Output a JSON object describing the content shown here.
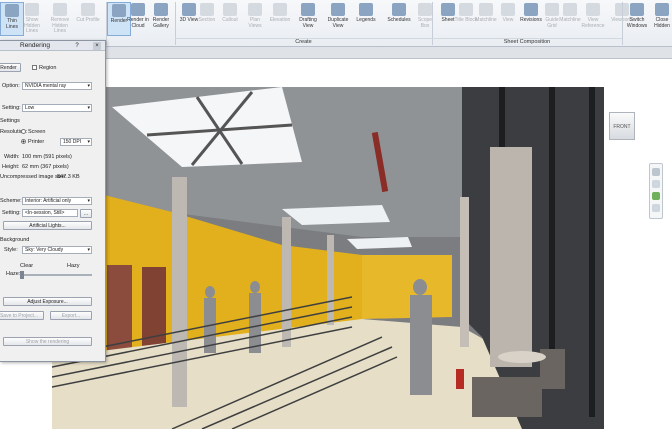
{
  "ribbon": {
    "buttons": [
      {
        "label": "Thin Lines",
        "state": "active"
      },
      {
        "label": "Show Hidden Lines",
        "state": "disabled"
      },
      {
        "label": "Remove Hidden Lines",
        "state": "disabled"
      },
      {
        "label": "Cut Profile",
        "state": "disabled"
      },
      {
        "label": "Render",
        "state": "active"
      },
      {
        "label": "Render in Cloud",
        "state": "normal"
      },
      {
        "label": "Render Gallery",
        "state": "normal"
      },
      {
        "label": "3D View",
        "state": "normal"
      },
      {
        "label": "Section",
        "state": "disabled"
      },
      {
        "label": "Callout",
        "state": "disabled"
      },
      {
        "label": "Plan Views",
        "state": "disabled"
      },
      {
        "label": "Elevation",
        "state": "disabled"
      },
      {
        "label": "Drafting View",
        "state": "normal"
      },
      {
        "label": "Duplicate View",
        "state": "normal"
      },
      {
        "label": "Legends",
        "state": "normal"
      },
      {
        "label": "Schedules",
        "state": "normal"
      },
      {
        "label": "Scope Box",
        "state": "disabled"
      },
      {
        "label": "Sheet",
        "state": "normal"
      },
      {
        "label": "Title Block",
        "state": "disabled"
      },
      {
        "label": "Matchline",
        "state": "disabled"
      },
      {
        "label": "View",
        "state": "disabled"
      },
      {
        "label": "Revisions",
        "state": "normal"
      },
      {
        "label": "Guide Grid",
        "state": "disabled"
      },
      {
        "label": "Matchline",
        "state": "disabled"
      },
      {
        "label": "View Reference",
        "state": "disabled"
      },
      {
        "label": "Viewports",
        "state": "disabled"
      },
      {
        "label": "Switch Windows",
        "state": "normal"
      },
      {
        "label": "Close Hidden",
        "state": "normal"
      }
    ],
    "groups": {
      "create": "Create",
      "sheet": "Sheet Composition"
    }
  },
  "dialog": {
    "title": "Rendering",
    "help": "?",
    "close": "×",
    "render_btn": "Render",
    "region_label": "Region",
    "option_label": "Option:",
    "option_value": "NVIDIA mental ray",
    "quality_label": "Setting:",
    "quality_value": "Low",
    "settings_heading": "Settings",
    "resolution_label": "Resolution:",
    "screen_label": "Screen",
    "printer_label": "Printer",
    "dpi_value": "150 DPI",
    "width_label": "Width:",
    "width_value": "100 mm (591 pixels)",
    "height_label": "Height:",
    "height_value": "62 mm (367 pixels)",
    "size_label": "Uncompressed image size:",
    "size_value": "847.3 KB",
    "scheme_label": "Scheme:",
    "scheme_value": "Interior: Artificial only",
    "lights_setting_label": "Setting:",
    "lights_setting_value": "<In-session, Still>",
    "more_btn": "...",
    "artificial_btn": "Artificial Lights...",
    "background_heading": "Background",
    "style_label": "Style:",
    "style_value": "Sky: Very Cloudy",
    "clear_label": "Clear",
    "hazy_label": "Hazy",
    "haze_label": "Haze:",
    "adjust_btn": "Adjust Exposure...",
    "save_btn": "Save to Project...",
    "export_btn": "Export...",
    "show_btn": "Show the rendering"
  },
  "viewport": {
    "viewcube": "FRONT"
  },
  "colors": {
    "accent": "#cfe3f7",
    "wall": "#e0b21e"
  }
}
